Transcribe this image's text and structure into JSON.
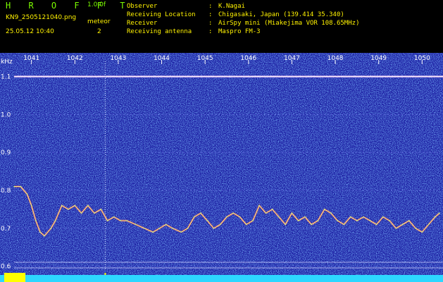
{
  "header": {
    "app_name": "H R O F F T",
    "version": "1.0.0f",
    "filename": "KN9_2505121040.png",
    "datetime": "25.05.12 10:40",
    "meteor_label": "meteor",
    "meteor_count": "2",
    "info_rows": [
      {
        "key": "Observer",
        "value": "K.Nagai"
      },
      {
        "key": "Receiving Location",
        "value": "Chigasaki, Japan (139.414 35.340)"
      },
      {
        "key": "Receiver",
        "value": "AirSpy mini (Miakejima VOR 108.65MHz)"
      },
      {
        "key": "Receiving antenna",
        "value": "Maspro FM-3"
      }
    ]
  },
  "colors": {
    "background": "#1a1aa0",
    "noise": "#3a8cff",
    "trace": "#ffe680",
    "text_header": "#fff200",
    "text_logo": "#7cfc00",
    "baseline": "#2dd7ff",
    "marker": "#ffff00"
  },
  "chart_data": {
    "type": "line",
    "title": "",
    "xlabel": "",
    "ylabel": "kHz",
    "x_ticks": [
      "1041",
      "1042",
      "1043",
      "1044",
      "1045",
      "1046",
      "1047",
      "1048",
      "1049",
      "1050"
    ],
    "y_ticks": [
      "0.6",
      "0.7",
      "0.8",
      "0.9",
      "1.0",
      "1.1"
    ],
    "xlim": [
      1040.6,
      1050.4
    ],
    "ylim": [
      0.59,
      1.14
    ],
    "carrier_khz": 1.1,
    "meteor_markers_x": [
      1042.7
    ],
    "series": [
      {
        "x": [
          1040.6,
          1040.75,
          1040.9,
          1041.0,
          1041.1,
          1041.2,
          1041.3,
          1041.45,
          1041.55,
          1041.7,
          1041.85,
          1042.0,
          1042.15,
          1042.3,
          1042.45,
          1042.6,
          1042.75,
          1042.9,
          1043.05,
          1043.2,
          1043.4,
          1043.6,
          1043.8,
          1043.95,
          1044.1,
          1044.25,
          1044.45,
          1044.6,
          1044.75,
          1044.9,
          1045.05,
          1045.2,
          1045.35,
          1045.5,
          1045.65,
          1045.8,
          1045.95,
          1046.1,
          1046.25,
          1046.4,
          1046.55,
          1046.7,
          1046.85,
          1047.0,
          1047.15,
          1047.3,
          1047.45,
          1047.6,
          1047.75,
          1047.9,
          1048.05,
          1048.2,
          1048.35,
          1048.5,
          1048.65,
          1048.8,
          1048.95,
          1049.1,
          1049.25,
          1049.4,
          1049.55,
          1049.7,
          1049.85,
          1050.0,
          1050.15,
          1050.3,
          1050.4
        ],
        "y": [
          0.81,
          0.81,
          0.79,
          0.76,
          0.72,
          0.69,
          0.68,
          0.7,
          0.72,
          0.76,
          0.75,
          0.76,
          0.74,
          0.76,
          0.74,
          0.75,
          0.72,
          0.73,
          0.72,
          0.72,
          0.71,
          0.7,
          0.69,
          0.7,
          0.71,
          0.7,
          0.69,
          0.7,
          0.73,
          0.74,
          0.72,
          0.7,
          0.71,
          0.73,
          0.74,
          0.73,
          0.71,
          0.72,
          0.76,
          0.74,
          0.75,
          0.73,
          0.71,
          0.74,
          0.72,
          0.73,
          0.71,
          0.72,
          0.75,
          0.74,
          0.72,
          0.71,
          0.73,
          0.72,
          0.73,
          0.72,
          0.71,
          0.73,
          0.72,
          0.7,
          0.71,
          0.72,
          0.7,
          0.69,
          0.71,
          0.73,
          0.74
        ]
      }
    ]
  }
}
